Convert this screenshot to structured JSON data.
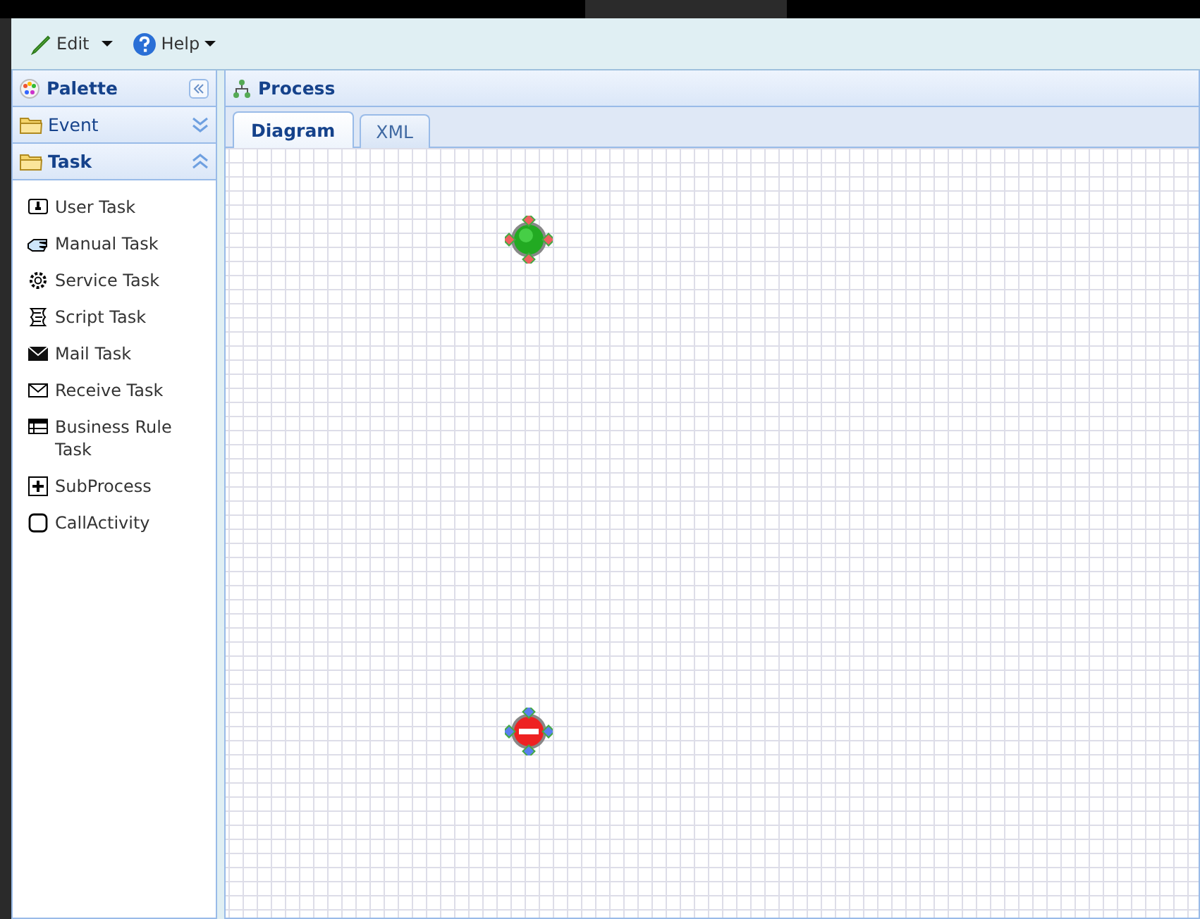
{
  "toolbar": [
    {
      "label": "Edit"
    },
    {
      "label": "Help"
    }
  ],
  "palette": {
    "title": "Palette",
    "groups": [
      {
        "label": "Event",
        "expanded": false
      },
      {
        "label": "Task",
        "expanded": true,
        "items": [
          {
            "label": "User Task"
          },
          {
            "label": "Manual Task"
          },
          {
            "label": "Service Task"
          },
          {
            "label": "Script Task"
          },
          {
            "label": "Mail Task"
          },
          {
            "label": "Receive Task"
          },
          {
            "label": "Business Rule Task"
          },
          {
            "label": "SubProcess"
          },
          {
            "label": "CallActivity"
          }
        ]
      }
    ]
  },
  "process": {
    "title": "Process",
    "tabs": [
      {
        "label": "Diagram",
        "selected": true
      },
      {
        "label": "XML",
        "selected": false
      }
    ],
    "nodes": [
      {
        "kind": "start",
        "selected": true
      },
      {
        "kind": "end",
        "selected": true
      }
    ]
  }
}
